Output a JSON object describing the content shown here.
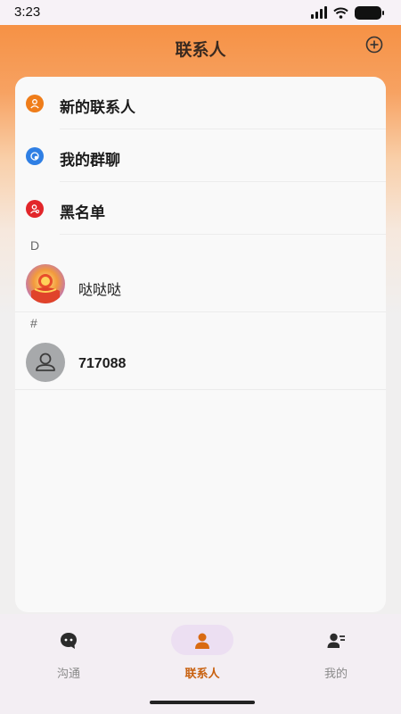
{
  "status_bar": {
    "time": "3:23"
  },
  "header": {
    "title": "联系人"
  },
  "menu": [
    {
      "label": "新的联系人",
      "icon": "new-contact-icon",
      "color": "#ef7d1a"
    },
    {
      "label": "我的群聊",
      "icon": "group-chat-icon",
      "color": "#2f7fe4"
    },
    {
      "label": "黑名单",
      "icon": "blacklist-icon",
      "color": "#e2262a"
    }
  ],
  "sections": [
    {
      "letter": "D",
      "contacts": [
        {
          "name": "哒哒哒",
          "avatar": "festive-avatar"
        }
      ]
    },
    {
      "letter": "#",
      "contacts": [
        {
          "name": "717088",
          "avatar": "default-person-avatar"
        }
      ]
    }
  ],
  "tabbar": {
    "tabs": [
      {
        "label": "沟通",
        "icon": "chat-bubble-icon",
        "active": false
      },
      {
        "label": "联系人",
        "icon": "person-icon",
        "active": true
      },
      {
        "label": "我的",
        "icon": "profile-list-icon",
        "active": false
      }
    ]
  },
  "colors": {
    "accent": "#f58b3a",
    "active_tab": "#c8600e",
    "active_pill": "#ecdff2"
  }
}
